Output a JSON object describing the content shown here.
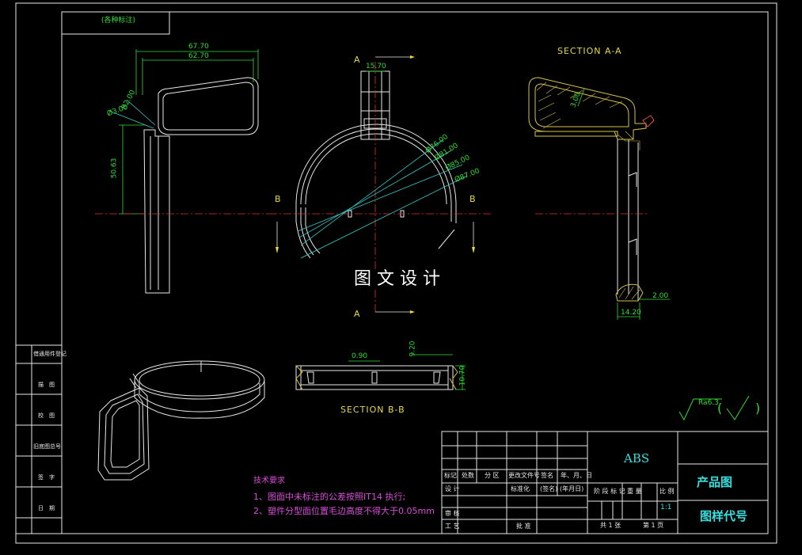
{
  "header_stamp": "(各种标注)",
  "views": {
    "section_aa_title": "SECTION A-A",
    "section_bb_title": "SECTION B-B",
    "cut_label_a": "A",
    "cut_label_b": "B"
  },
  "dimensions": {
    "d_67_70": "67.70",
    "d_62_70": "62.70",
    "d_phi3": "Ø3.00",
    "d_r2": "R2.00",
    "d_50_63": "50.63",
    "d_15_70": "15.70",
    "d_phi76": "Ø76.00",
    "d_phi81": "Ø81.00",
    "d_phi85": "Ø85.00",
    "d_phi87": "Ø87.00",
    "d_3_00": "3.00",
    "d_2_00": "2.00",
    "d_14_20": "14.20",
    "d_0_90": "0.90",
    "d_9_20": "9.20",
    "d_10_70": "10.70"
  },
  "watermark": "图 文 设 计",
  "roughness": {
    "value": "Ra6.3",
    "paren_open": "(",
    "paren_close": ")"
  },
  "left_strip": [
    "借通用件登记",
    "描　图",
    "校　图",
    "旧底图总号",
    "签　字",
    "日　期"
  ],
  "tech_req": {
    "title": "技术要求",
    "line1": "1、图面中未标注的公差按照IT14 执行;",
    "line2": "2、塑件分型面位置毛边高度不得大于0.05mm"
  },
  "title_block": {
    "material": "ABS",
    "r_mark": "标记",
    "r_count": "处数",
    "r_zone": "分 区",
    "r_docno": "更改文件号",
    "r_sign": "签名",
    "r_date": "年、月、日",
    "design": "设 计",
    "standard": "标准化",
    "sign_paren": "(签名)",
    "date_paren": "(年月日)",
    "stage_mark": "阶 段 标 记",
    "weight": "重 量",
    "scale": "比 例",
    "scale_value": "1:1",
    "review": "审 核",
    "process": "工 艺",
    "approve": "批 准",
    "sheets_total": "共 1 张",
    "sheet_no": "第 1 页",
    "drawing_name": "产品图",
    "drawing_code": "图样代号"
  },
  "colors": {
    "line": "#e8e8e8",
    "dimension": "#2fdc2f",
    "center": "#e03030",
    "leader": "#36c8c8",
    "section_title": "#e6d94c",
    "hatch": "#d9c24a",
    "tech": "#d84cd8",
    "title_text": "#34e0e0"
  }
}
